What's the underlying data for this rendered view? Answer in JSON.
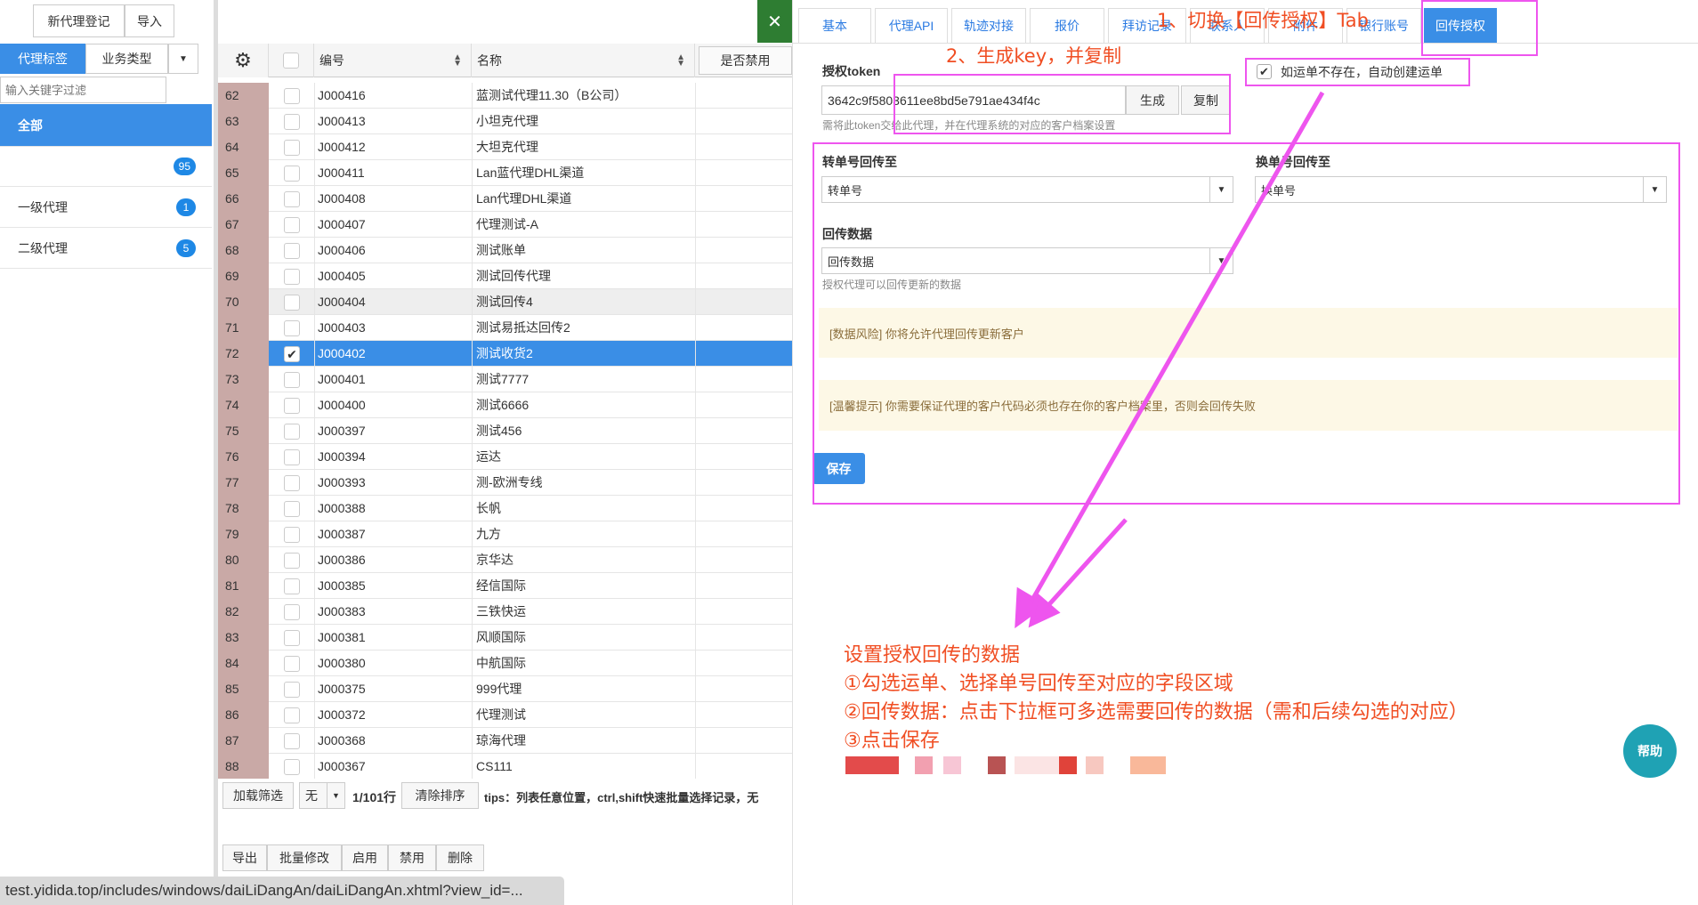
{
  "left": {
    "top_buttons": [
      "新代理登记",
      "导入"
    ],
    "tabs": [
      "代理标签",
      "业务类型"
    ],
    "filter_placeholder": "输入关键字过滤",
    "nav": [
      {
        "label": "全部",
        "count": ""
      },
      {
        "label": "",
        "count": "95"
      },
      {
        "label": "一级代理",
        "count": "1"
      },
      {
        "label": "二级代理",
        "count": "5"
      }
    ]
  },
  "table": {
    "headers": {
      "code": "编号",
      "name": "名称",
      "disabled": "是否禁用"
    },
    "rows": [
      {
        "idx": "62",
        "code": "J000416",
        "name": "蓝测试代理11.30（B公司）"
      },
      {
        "idx": "63",
        "code": "J000413",
        "name": "小坦克代理"
      },
      {
        "idx": "64",
        "code": "J000412",
        "name": "大坦克代理"
      },
      {
        "idx": "65",
        "code": "J000411",
        "name": "Lan蓝代理DHL渠道"
      },
      {
        "idx": "66",
        "code": "J000408",
        "name": "Lan代理DHL渠道"
      },
      {
        "idx": "67",
        "code": "J000407",
        "name": "代理测试-A"
      },
      {
        "idx": "68",
        "code": "J000406",
        "name": "测试账单"
      },
      {
        "idx": "69",
        "code": "J000405",
        "name": "测试回传代理"
      },
      {
        "idx": "70",
        "code": "J000404",
        "name": "测试回传4"
      },
      {
        "idx": "71",
        "code": "J000403",
        "name": "测试易抵达回传2"
      },
      {
        "idx": "72",
        "code": "J000402",
        "name": "测试收货2"
      },
      {
        "idx": "73",
        "code": "J000401",
        "name": "测试7777"
      },
      {
        "idx": "74",
        "code": "J000400",
        "name": "测试6666"
      },
      {
        "idx": "75",
        "code": "J000397",
        "name": "测试456"
      },
      {
        "idx": "76",
        "code": "J000394",
        "name": "运达"
      },
      {
        "idx": "77",
        "code": "J000393",
        "name": "测-欧洲专线"
      },
      {
        "idx": "78",
        "code": "J000388",
        "name": "长帆"
      },
      {
        "idx": "79",
        "code": "J000387",
        "name": "九方"
      },
      {
        "idx": "80",
        "code": "J000386",
        "name": "京华达"
      },
      {
        "idx": "81",
        "code": "J000385",
        "name": "经信国际"
      },
      {
        "idx": "82",
        "code": "J000383",
        "name": "三铁快运"
      },
      {
        "idx": "83",
        "code": "J000381",
        "name": "风顺国际"
      },
      {
        "idx": "84",
        "code": "J000380",
        "name": "中航国际"
      },
      {
        "idx": "85",
        "code": "J000375",
        "name": "999代理"
      },
      {
        "idx": "86",
        "code": "J000372",
        "name": "代理测试"
      },
      {
        "idx": "87",
        "code": "J000368",
        "name": "琼海代理"
      },
      {
        "idx": "88",
        "code": "J000367",
        "name": "CS111"
      }
    ],
    "toolbar": {
      "load_filter": "加载筛选",
      "none": "无",
      "page_info": "1/101行",
      "clear_sort": "清除排序",
      "tips": "tips：列表任意位置，ctrl,shift快速批量选择记录，无"
    },
    "actions": [
      "导出",
      "批量修改",
      "启用",
      "禁用",
      "删除"
    ]
  },
  "status_url": "test.yidida.top/includes/windows/daiLiDangAn/daiLiDangAn.xhtml?view_id=...",
  "right": {
    "tabs": [
      "基本",
      "代理API",
      "轨迹对接",
      "报价",
      "拜访记录",
      "联系人",
      "附件",
      "银行账号",
      "回传授权"
    ],
    "token_label": "授权token",
    "token_value": "3642c9f5803611ee8bd5e791ae434f4c",
    "generate": "生成",
    "copy": "复制",
    "token_hint": "需将此token交给此代理，并在代理系统的对应的客户档案设置",
    "auto_create": "如运单不存在，自动创建运单",
    "transfer_label": "转单号回传至",
    "transfer_value": "转单号",
    "change_label": "换单号回传至",
    "change_value": "换单号",
    "data_label": "回传数据",
    "data_value": "回传数据",
    "data_hint": "授权代理可以回传更新的数据",
    "risk_notice": "[数据风险] 你将允许代理回传更新客户",
    "warm_notice": "[温馨提示] 你需要保证代理的客户代码必须也存在你的客户档案里，否则会回传失败",
    "save": "保存",
    "help": "帮助"
  },
  "annotations": {
    "step1": "1、切换【回传授权】Tab",
    "step2": "2、生成key，并复制",
    "desc_title": "设置授权回传的数据",
    "desc_1": "①勾选运单、选择单号回传至对应的字段区域",
    "desc_2": "②回传数据：点击下拉框可多选需要回传的数据（需和后续勾选的对应）",
    "desc_3": "③点击保存"
  },
  "colors": {
    "accent": "#3a8ee6",
    "annotation": "#ee55ee",
    "annotation_text": "#f04e23",
    "help": "#1fa2b4"
  }
}
